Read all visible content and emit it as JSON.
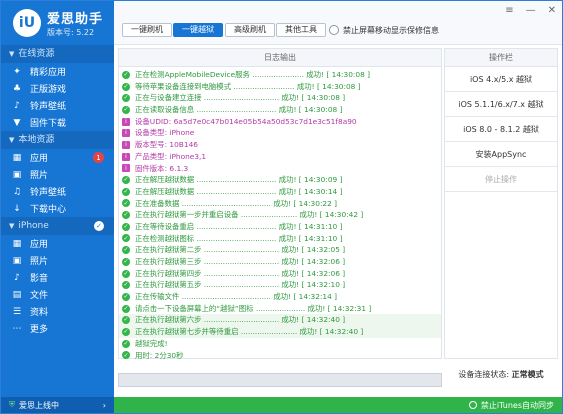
{
  "brand": {
    "logo_glyph": "iU",
    "title": "爱思助手",
    "version": "版本号: 5.22"
  },
  "sidebar": {
    "sections": [
      {
        "label": "在线资源",
        "items": [
          {
            "icon": "apps-icon",
            "glyph": "✦",
            "label": "精彩应用"
          },
          {
            "icon": "games-icon",
            "glyph": "♣",
            "label": "正版游戏"
          },
          {
            "icon": "ringtone-icon",
            "glyph": "♪",
            "label": "铃声壁纸"
          },
          {
            "icon": "download-icon",
            "glyph": "▼",
            "label": "固件下载"
          }
        ]
      },
      {
        "label": "本地资源",
        "items": [
          {
            "icon": "local-apps-icon",
            "glyph": "▦",
            "label": "应用",
            "badge": "1"
          },
          {
            "icon": "photos-icon",
            "glyph": "▣",
            "label": "照片"
          },
          {
            "icon": "ringtone-wallpaper-icon",
            "glyph": "♫",
            "label": "铃声壁纸"
          },
          {
            "icon": "download-center-icon",
            "glyph": "↓",
            "label": "下载中心"
          }
        ]
      },
      {
        "label": "iPhone",
        "check": "✓",
        "items": [
          {
            "icon": "device-apps-icon",
            "glyph": "▦",
            "label": "应用"
          },
          {
            "icon": "device-photos-icon",
            "glyph": "▣",
            "label": "照片"
          },
          {
            "icon": "music-icon",
            "glyph": "♪",
            "label": "影音"
          },
          {
            "icon": "files-icon",
            "glyph": "▤",
            "label": "文件"
          },
          {
            "icon": "info-icon",
            "glyph": "☰",
            "label": "资料"
          },
          {
            "icon": "more-icon",
            "glyph": "⋯",
            "label": "更多"
          }
        ]
      }
    ],
    "footer": {
      "label": "爱思上线中",
      "arrow": "›"
    }
  },
  "toolbar": {
    "buttons": [
      "一键刷机",
      "一键越狱",
      "高级刷机",
      "其他工具"
    ],
    "active_index": 1,
    "option_label": "禁止屏幕移动显示保修信息",
    "window_controls": [
      "≡",
      "—",
      "✕"
    ]
  },
  "log": {
    "header": "日志输出",
    "lines": [
      {
        "kind": "ok",
        "text": "正在检测AppleMobileDevice服务 ...................... 成功! [ 14:30:08 ]"
      },
      {
        "kind": "ok",
        "text": "等待苹果设备连接到电脑模式 .......................... 成功! [ 14:30:08 ]"
      },
      {
        "kind": "ok",
        "text": "正在与设备建立连接 ................................ 成功! [ 14:30:08 ]"
      },
      {
        "kind": "ok",
        "text": "正在读取设备信息 .................................. 成功! [ 14:30:08 ]"
      },
      {
        "kind": "info",
        "text": "设备UDID: 6a5d7e0c47b014e05b54a50d53c7d1e3c51f8a90"
      },
      {
        "kind": "info",
        "text": "设备类型: iPhone"
      },
      {
        "kind": "info",
        "text": "版本型号: 10B146"
      },
      {
        "kind": "info",
        "text": "产品类型: iPhone3,1"
      },
      {
        "kind": "info",
        "text": "固件版本: 6.1.3"
      },
      {
        "kind": "ok",
        "text": "正在解压越狱数据 .................................. 成功! [ 14:30:09 ]"
      },
      {
        "kind": "ok",
        "text": "正在解压越狱数据 .................................. 成功! [ 14:30:14 ]"
      },
      {
        "kind": "ok",
        "text": "正在准备数据 ...................................... 成功! [ 14:30:22 ]"
      },
      {
        "kind": "ok",
        "text": "正在执行越狱第一步并重启设备 ........................ 成功! [ 14:30:42 ]"
      },
      {
        "kind": "ok",
        "text": "正在等待设备重启 .................................. 成功! [ 14:31:10 ]"
      },
      {
        "kind": "ok",
        "text": "正在检测越狱图标 .................................. 成功! [ 14:31:10 ]"
      },
      {
        "kind": "ok",
        "text": "正在执行越狱第二步 ................................ 成功! [ 14:32:05 ]"
      },
      {
        "kind": "ok",
        "text": "正在执行越狱第三步 ................................ 成功! [ 14:32:06 ]"
      },
      {
        "kind": "ok",
        "text": "正在执行越狱第四步 ................................ 成功! [ 14:32:06 ]"
      },
      {
        "kind": "ok",
        "text": "正在执行越狱第五步 ................................ 成功! [ 14:32:10 ]"
      },
      {
        "kind": "ok",
        "text": "正在传输文件 ...................................... 成功! [ 14:32:14 ]"
      },
      {
        "kind": "ok",
        "text": "请点击一下设备屏幕上的“越狱”图标 ..................... 成功! [ 14:32:31 ]"
      },
      {
        "kind": "ok",
        "text": "正在执行越狱第六步 ................................ 成功! [ 14:32:40 ]"
      },
      {
        "kind": "ok",
        "text": "正在执行越狱第七步并等待重启 ........................ 成功! [ 14:32:40 ]"
      },
      {
        "kind": "ok",
        "text": "越狱完成!"
      },
      {
        "kind": "ok",
        "text": "用时: 2分30秒"
      }
    ],
    "progress": 0.0
  },
  "right_panel": {
    "header": "操作栏",
    "buttons": [
      {
        "label": "iOS 4.x/5.x 越狱",
        "enabled": true
      },
      {
        "label": "iOS 5.1.1/6.x/7.x 越狱",
        "enabled": true
      },
      {
        "label": "iOS 8.0 - 8.1.2 越狱",
        "enabled": true
      },
      {
        "label": "安装AppSync",
        "enabled": true
      },
      {
        "label": "停止操作",
        "enabled": false
      }
    ],
    "status_label": "设备连接状态:",
    "status_value": "正常模式"
  },
  "statusbar": {
    "label": "禁止iTunes自动同步"
  },
  "colors": {
    "accent": "#1776d4",
    "success": "#33b54a",
    "info": "#c948b8",
    "statusbar": "#30b44a"
  }
}
